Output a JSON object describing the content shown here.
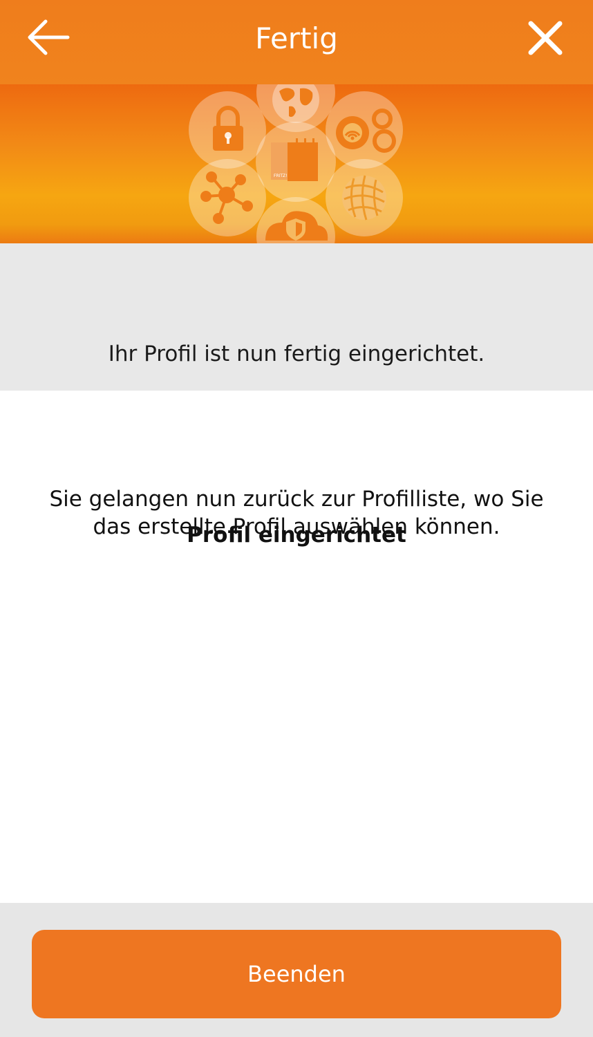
{
  "header": {
    "title": "Fertig",
    "back_icon": "arrow-left-icon",
    "close_icon": "close-icon"
  },
  "banner": {
    "icons": [
      "lock-icon",
      "globe-icon",
      "gears-wifi-icon",
      "router-icon",
      "network-nodes-icon",
      "cloud-shield-icon",
      "sphere-icon"
    ],
    "router_label": "FRITZ!"
  },
  "intro": {
    "heading": "Profil eingerichtet",
    "subtext": "Ihr Profil ist nun fertig eingerichtet."
  },
  "main": {
    "info_text": "Sie gelangen nun zurück zur Profilliste, wo Sie das erstellte Profil auswählen können."
  },
  "footer": {
    "button_label": "Beenden"
  },
  "colors": {
    "accent": "#ee7621",
    "header": "#ef7d1c",
    "intro_bg": "#e8e8e8",
    "footer_bg": "#e6e6e6"
  }
}
